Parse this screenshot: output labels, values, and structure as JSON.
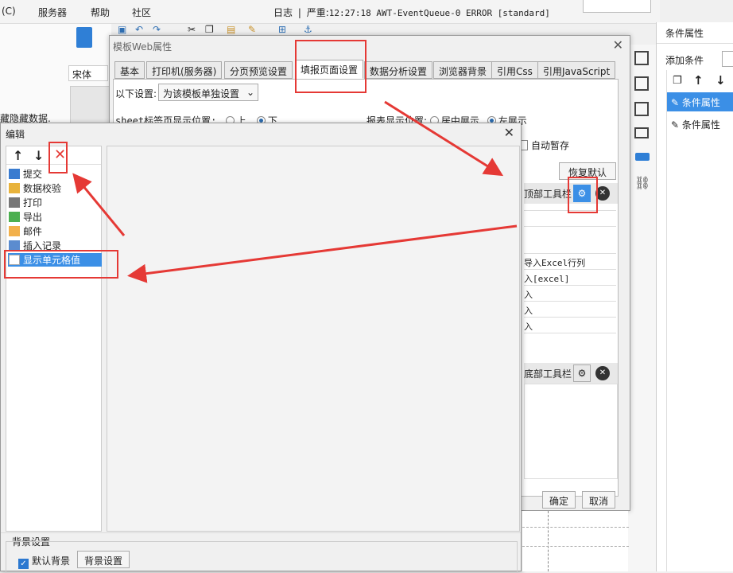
{
  "menubar": {
    "c_mark": "(C)",
    "server": "服务器",
    "help": "帮助",
    "community": "社区"
  },
  "logbar": {
    "label": "日志",
    "sep": "|",
    "level": "严重:",
    "message": "12:27:18 AWT-EventQueue-0 ERROR [standard]"
  },
  "left_panel": {
    "font_name": "宋体",
    "hidden_data_label": "藏隐藏数据."
  },
  "right_panel": {
    "header": "条件属性",
    "add_condition": "添加条件",
    "items": [
      "条件属性",
      "条件属性"
    ]
  },
  "web_dialog": {
    "title": "模板Web属性",
    "tabs": [
      "基本",
      "打印机(服务器)",
      "分页预览设置",
      "填报页面设置",
      "数据分析设置",
      "浏览器背景",
      "引用Css",
      "引用JavaScript"
    ],
    "settings_label": "以下设置:",
    "settings_value": "为该模板单独设置",
    "sheet_pos_label": "sheet标签页显示位置:",
    "sheet_pos_up": "上",
    "sheet_pos_down": "下",
    "report_pos_label": "报表显示位置:",
    "report_pos_center": "居中展示",
    "report_pos_left": "左展示",
    "auto_save": "自动暂存",
    "restore_default": "恢复默认",
    "top_toolbar": "顶部工具栏",
    "bottom_toolbar": "底部工具栏",
    "toolbar_rows": [
      "导入Excel行列",
      "入[excel]",
      "入",
      "入",
      "入"
    ],
    "ok": "确定",
    "cancel": "取消"
  },
  "edit_dialog": {
    "title": "编辑",
    "items": [
      "提交",
      "数据校验",
      "打印",
      "导出",
      "邮件",
      "插入记录",
      "显示单元格值"
    ],
    "bg_section": "背景设置",
    "default_bg": "默认背景",
    "bg_settings_button": "背景设置"
  },
  "accent_color": "#3b8fe6",
  "annotation_color": "#e53935"
}
